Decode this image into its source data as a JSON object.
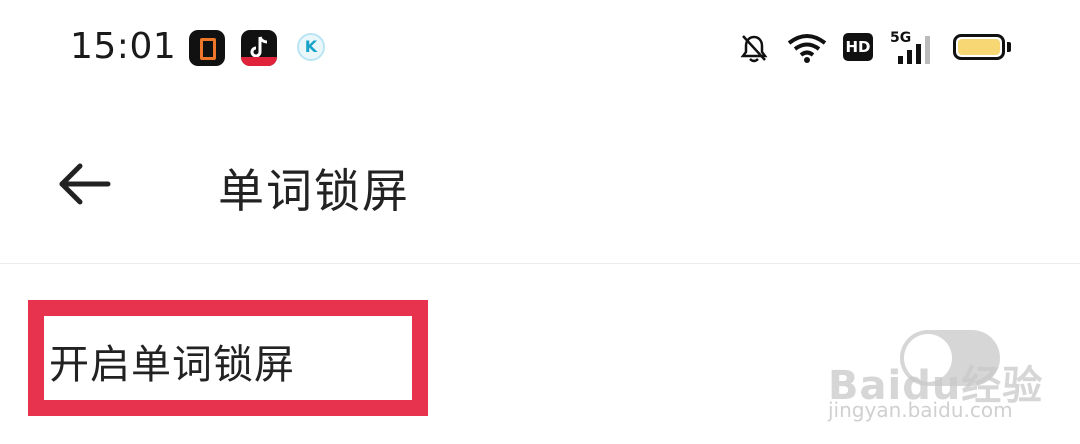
{
  "status_bar": {
    "time": "15:01",
    "apps": [
      "office-icon",
      "douyin-icon",
      "k-app-icon"
    ],
    "k_app_letter": "K",
    "hd_label": "HD",
    "network_label": "5G",
    "battery_color": "#f7d774"
  },
  "header": {
    "title": "单词锁屏"
  },
  "settings": {
    "lock_screen_label": "开启单词锁屏",
    "lock_screen_enabled": false,
    "highlight_color": "#e8334e"
  },
  "watermark": {
    "logo_text": "Baidu经验",
    "url": "jingyan.baidu.com"
  }
}
